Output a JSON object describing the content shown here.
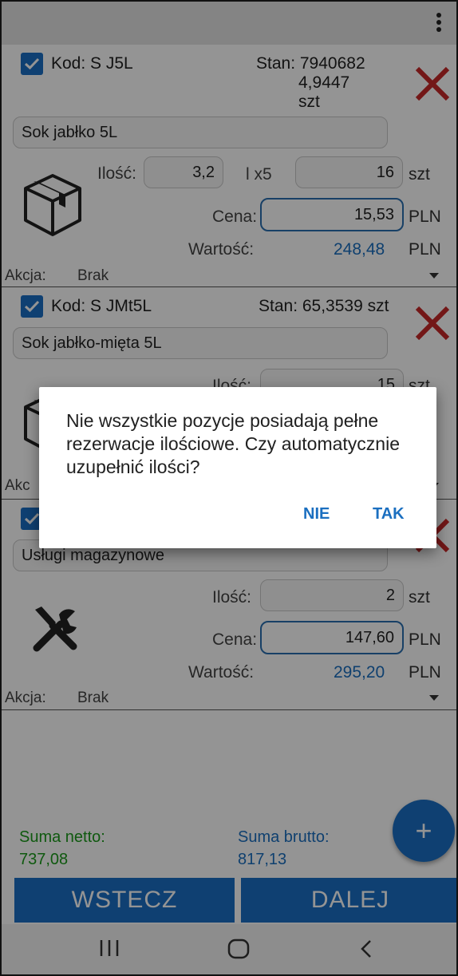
{
  "items": [
    {
      "kod": "Kod: S J5L",
      "stan_lines": [
        "Stan: 7940682",
        "4,9447",
        "szt"
      ],
      "name": "Sok jabłko 5L",
      "ilosc_label": "Ilość:",
      "ilosc": "3,2",
      "multiplier": "l x5",
      "ilosc2": "16",
      "ilosc_unit": "szt",
      "cena_label": "Cena:",
      "cena": "15,53",
      "cena_unit": "PLN",
      "wartosc_label": "Wartość:",
      "wartosc": "248,48",
      "wartosc_unit": "PLN",
      "akcja_label": "Akcja:",
      "akcja": "Brak"
    },
    {
      "kod": "Kod: S JMt5L",
      "stan": "Stan: 65,3539 szt",
      "name": "Sok jabłko-mięta 5L",
      "ilosc_label": "Ilość:",
      "ilosc": "15",
      "ilosc_unit": "szt",
      "akcja_label": "Akc"
    },
    {
      "name": "Usługi magazynowe",
      "ilosc_label": "Ilość:",
      "ilosc": "2",
      "ilosc_unit": "szt",
      "cena_label": "Cena:",
      "cena": "147,60",
      "cena_unit": "PLN",
      "wartosc_label": "Wartość:",
      "wartosc": "295,20",
      "wartosc_unit": "PLN",
      "akcja_label": "Akcja:",
      "akcja": "Brak"
    }
  ],
  "summary": {
    "netto_label": "Suma netto:",
    "netto": "737,08",
    "brutto_label": "Suma brutto:",
    "brutto": "817,13"
  },
  "fab_label": "+",
  "buttons": {
    "back": "WSTECZ",
    "next": "DALEJ"
  },
  "dialog": {
    "message": "Nie wszystkie pozycje posiadają pełne rezerwacje ilościowe. Czy automatycznie uzupełnić ilości?",
    "no": "NIE",
    "yes": "TAK"
  },
  "colors": {
    "accent": "#1a6fc4",
    "delete": "#c62828",
    "netto": "#1a9a1a"
  },
  "icons": [
    "kebab-menu-icon",
    "checkbox-checked-icon",
    "delete-x-icon",
    "box-icon",
    "tools-icon",
    "dropdown-arrow-icon",
    "recents-icon",
    "home-icon",
    "back-icon"
  ]
}
